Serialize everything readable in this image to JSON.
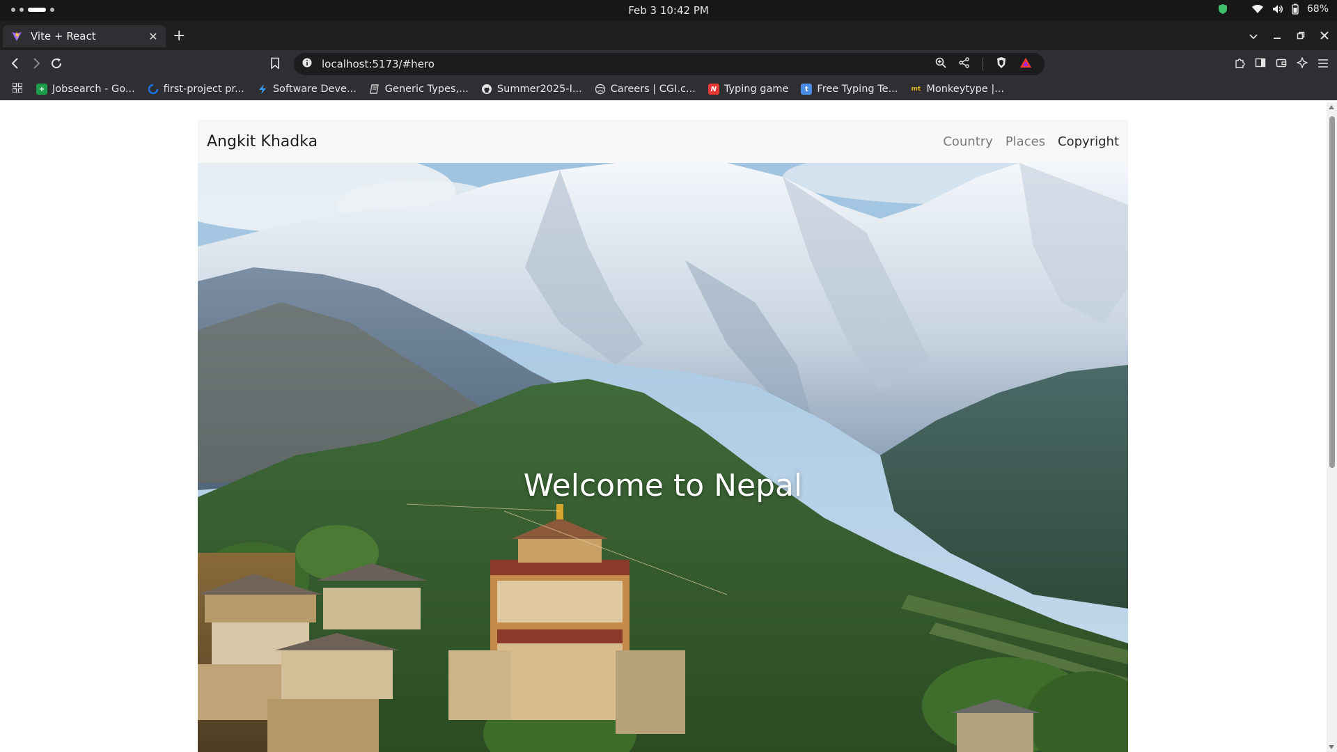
{
  "os": {
    "clock": "Feb 3  10:42 PM",
    "battery": "68%"
  },
  "browser": {
    "tab": {
      "title": "Vite + React"
    },
    "url": "localhost:5173/#hero",
    "bookmarks": [
      {
        "label": "Jobsearch - Go...",
        "icon": "sheets-icon",
        "color": "#1e9e4a"
      },
      {
        "label": "first-project pr...",
        "icon": "spinner-icon",
        "color": "#1a73e8"
      },
      {
        "label": "Software Deve...",
        "icon": "bolt-icon",
        "color": "#3aa0ff"
      },
      {
        "label": "Generic Types,...",
        "icon": "book-icon",
        "color": "#cfcfcf"
      },
      {
        "label": "Summer2025-I...",
        "icon": "github-icon",
        "color": "#e6e6e6"
      },
      {
        "label": "Careers | CGI.c...",
        "icon": "globe-icon",
        "color": "#d0d0d0"
      },
      {
        "label": "Typing game",
        "icon": "n-icon",
        "color": "#e53935"
      },
      {
        "label": "Free Typing Te...",
        "icon": "t-icon",
        "color": "#4a8fe7"
      },
      {
        "label": "Monkeytype |...",
        "icon": "mt-icon",
        "color": "#e2b714"
      }
    ]
  },
  "page": {
    "brand": "Angkit Khadka",
    "nav": [
      {
        "label": "Country",
        "active": false
      },
      {
        "label": "Places",
        "active": false
      },
      {
        "label": "Copyright",
        "active": true
      }
    ],
    "hero_title": "Welcome to Nepal"
  },
  "colors": {
    "os_bar": "#171717",
    "tab_strip": "#1f1f1f",
    "toolbar": "#2f2f33",
    "navbar_bg": "#f8f8f9",
    "hero_text": "#ffffff"
  }
}
